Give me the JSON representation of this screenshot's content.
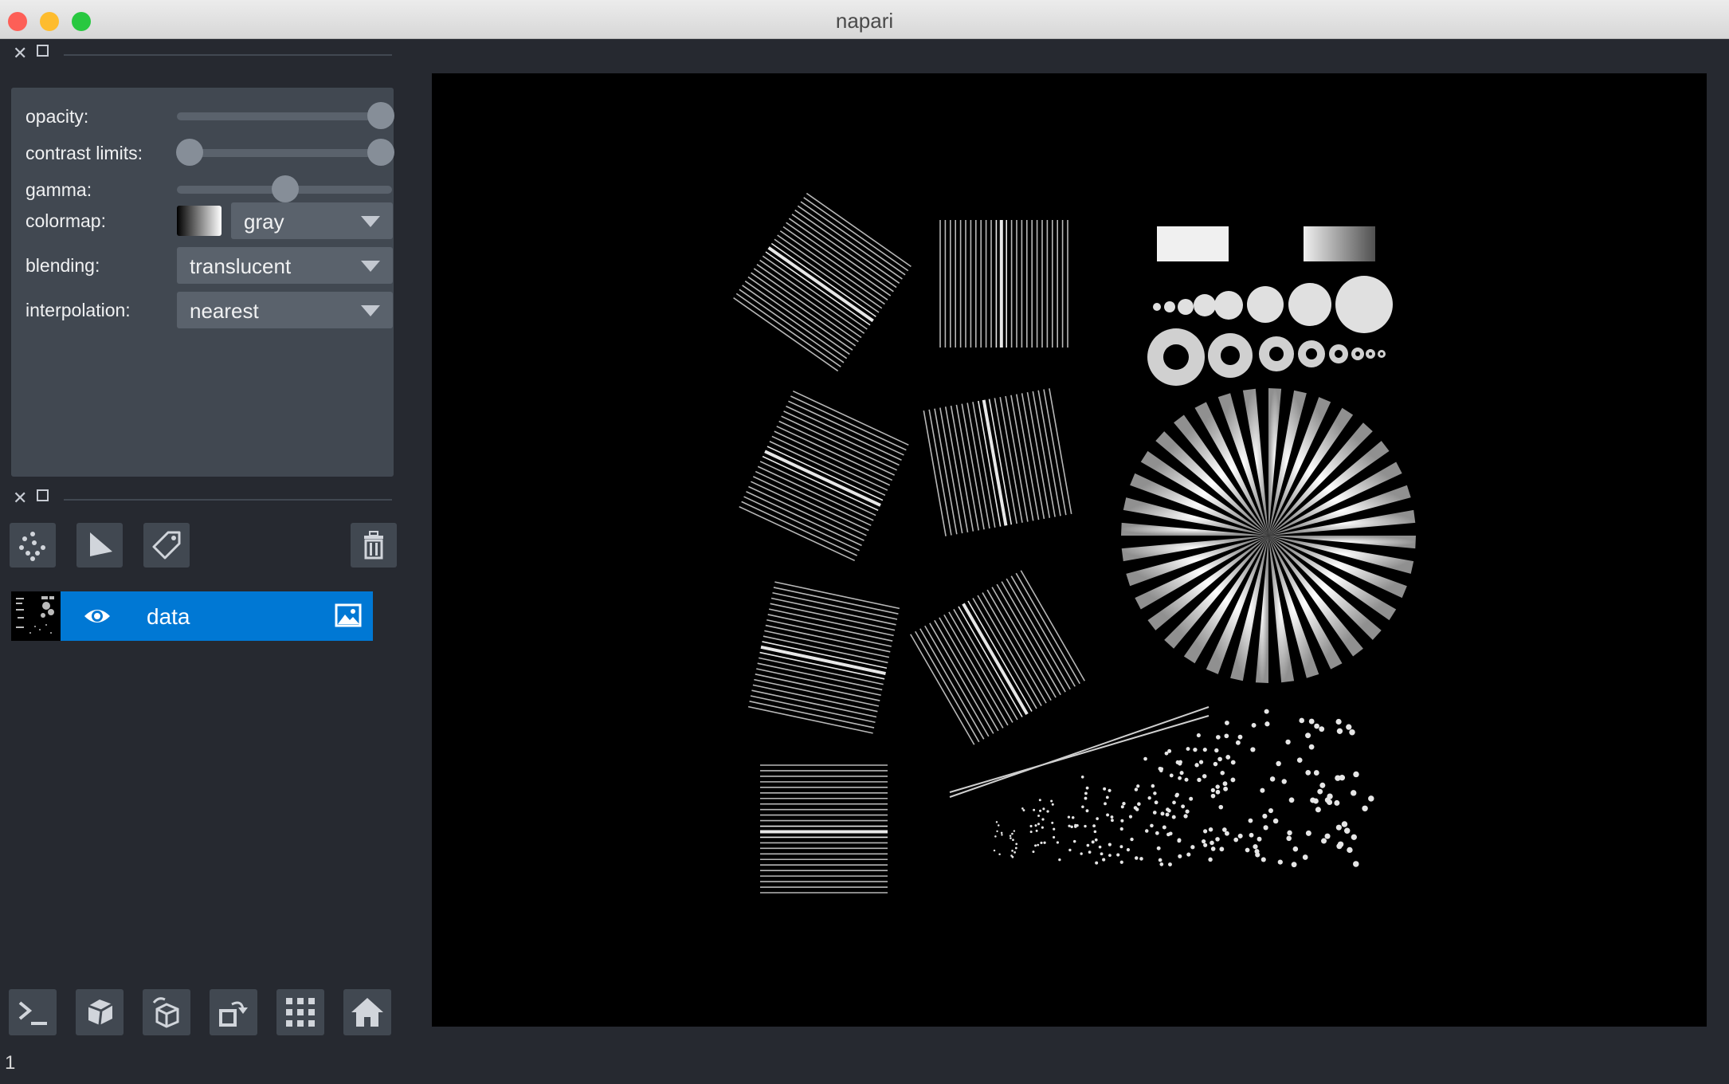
{
  "window": {
    "title": "napari"
  },
  "layer_controls": {
    "opacity_label": "opacity:",
    "opacity_value": 1.0,
    "contrast_limits_label": "contrast limits:",
    "contrast_limits_value": [
      0.0,
      1.0
    ],
    "gamma_label": "gamma:",
    "gamma_value": 1.0,
    "colormap_label": "colormap:",
    "colormap_value": "gray",
    "blending_label": "blending:",
    "blending_value": "translucent",
    "interpolation_label": "interpolation:",
    "interpolation_value": "nearest"
  },
  "layer_buttons": [
    "new-points-icon",
    "new-shapes-icon",
    "new-labels-icon",
    "delete-layer-icon"
  ],
  "layers": [
    {
      "name": "data",
      "visible": true,
      "type_icon": "image-icon"
    }
  ],
  "viewer_buttons": [
    "console-icon",
    "ndisplay-3d-icon",
    "roll-dims-icon",
    "transpose-dims-icon",
    "grid-icon",
    "home-icon"
  ],
  "status": {
    "text": "1"
  },
  "colors": {
    "background": "#262930",
    "panel": "#414851",
    "selected_layer": "#0078d4",
    "canvas": "#000000"
  }
}
